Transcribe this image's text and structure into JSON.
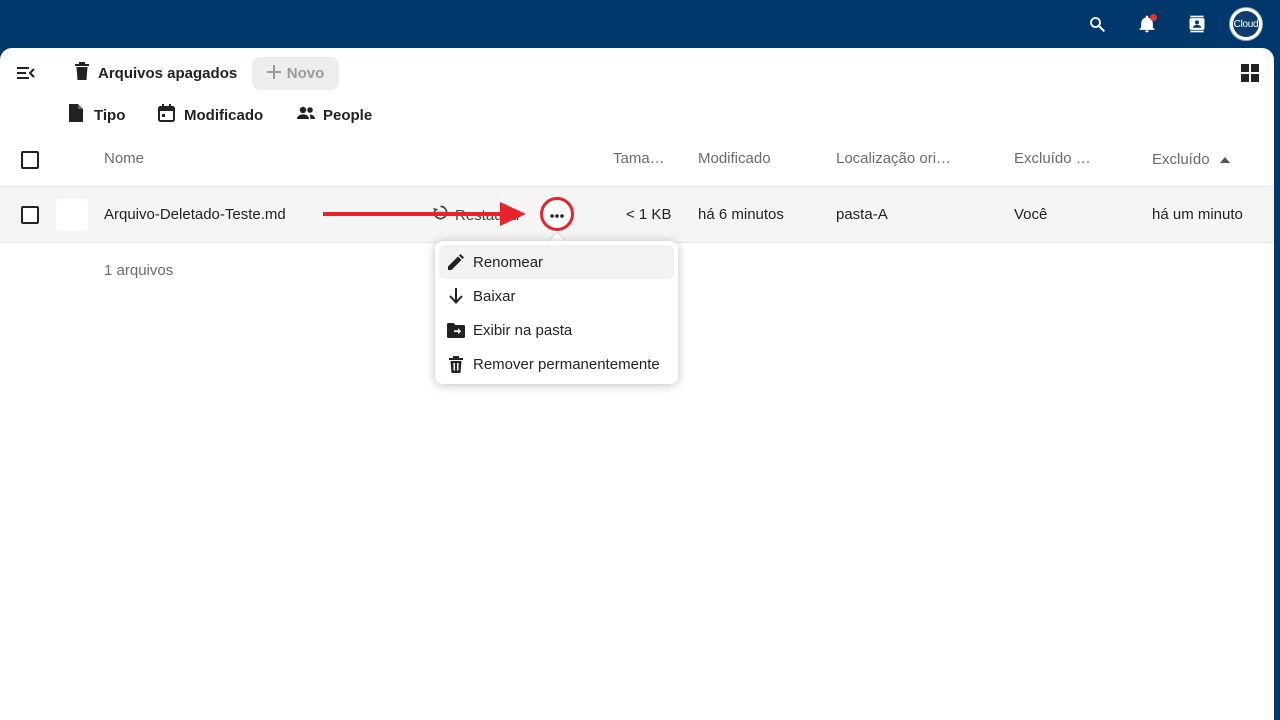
{
  "topbar": {
    "search_icon": "search-icon",
    "notifications_icon": "bell-icon",
    "contacts_icon": "contacts-icon",
    "avatar_label": "Cloud",
    "background": "#00386b"
  },
  "header": {
    "menu_toggle_icon": "menu-collapse-icon",
    "breadcrumb_label": "Arquivos apagados",
    "new_button_label": "Novo",
    "grid_view_icon": "grid-view-icon"
  },
  "filters": [
    {
      "label": "Tipo",
      "icon": "file-icon"
    },
    {
      "label": "Modificado",
      "icon": "calendar-icon"
    },
    {
      "label": "People",
      "icon": "people-icon"
    }
  ],
  "table": {
    "columns": {
      "name": "Nome",
      "size": "Tama…",
      "modified": "Modificado",
      "original_location": "Localização ori…",
      "deleted_by": "Excluído …",
      "deleted": "Excluído"
    },
    "rows": [
      {
        "name": "Arquivo-Deletado-Teste.md",
        "restore_label": "Restaurar",
        "size": "< 1 KB",
        "modified": "há 6 minutos",
        "original_location": "pasta-A",
        "deleted_by": "Você",
        "deleted": "há um minuto"
      }
    ],
    "summary": "1 arquivos"
  },
  "context_menu": {
    "items": [
      {
        "label": "Renomear",
        "icon": "pencil-icon"
      },
      {
        "label": "Baixar",
        "icon": "download-icon"
      },
      {
        "label": "Exibir na pasta",
        "icon": "folder-move-icon"
      },
      {
        "label": "Remover permanentemente",
        "icon": "trash-icon"
      }
    ]
  },
  "annotation": {
    "color": "#e8242a"
  }
}
